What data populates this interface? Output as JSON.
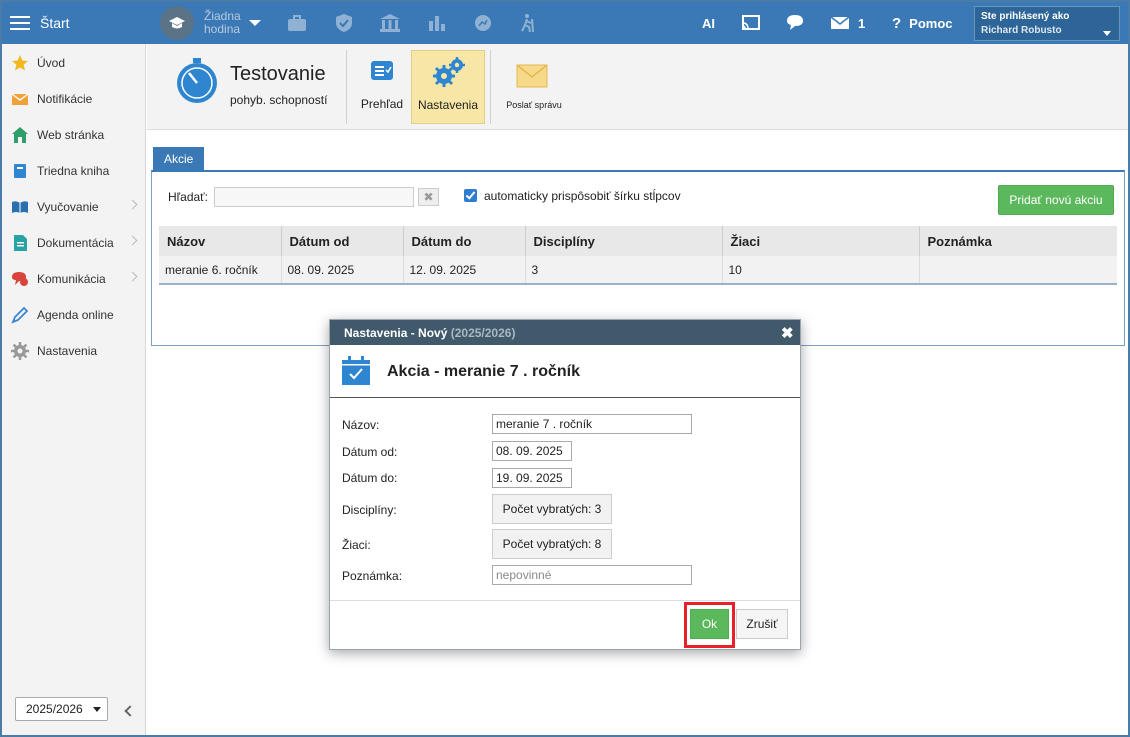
{
  "topbar": {
    "start_label": "Štart",
    "hour_line1": "Žiadna",
    "hour_line2": "hodina",
    "ai_label": "AI",
    "messages_count": "1",
    "help_label": "Pomoc",
    "user_caption": "Ste prihlásený ako",
    "user_name": "Richard Robusto",
    "icons": [
      "briefcase-icon",
      "shield-icon",
      "school-icon",
      "bar-chart-icon",
      "running-ball-icon",
      "hiking-icon",
      "cast-icon",
      "chat-icon",
      "envelope-icon",
      "help-icon"
    ]
  },
  "sidebar": {
    "items": [
      {
        "label": "Úvod",
        "icon": "star-icon"
      },
      {
        "label": "Notifikácie",
        "icon": "envelope-icon"
      },
      {
        "label": "Web stránka",
        "icon": "home-icon"
      },
      {
        "label": "Triedna kniha",
        "icon": "book-icon"
      },
      {
        "label": "Vyučovanie",
        "icon": "open-book-icon"
      },
      {
        "label": "Dokumentácia",
        "icon": "document-icon"
      },
      {
        "label": "Komunikácia",
        "icon": "chat-icon"
      },
      {
        "label": "Agenda online",
        "icon": "pen-icon"
      },
      {
        "label": "Nastavenia",
        "icon": "gear-icon"
      }
    ],
    "year_selected": "2025/2026"
  },
  "module": {
    "title": "Testovanie",
    "subtitle": "pohyb. schopností",
    "tools": {
      "overview": "Prehľad",
      "settings": "Nastavenia",
      "send_message": "Poslať správu"
    }
  },
  "content": {
    "tab_label": "Akcie",
    "search_label": "Hľadať:",
    "search_value": "",
    "autofit_label": "automaticky prispôsobiť šírku stĺpcov",
    "autofit_checked": true,
    "add_button": "Pridať novú akciu",
    "table": {
      "columns": [
        "Názov",
        "Dátum od",
        "Dátum do",
        "Disciplíny",
        "Žiaci",
        "Poznámka"
      ],
      "rows": [
        [
          "meranie 6. ročník",
          "08. 09. 2025",
          "12. 09. 2025",
          "3",
          "10",
          ""
        ]
      ]
    }
  },
  "dialog": {
    "header_title": "Nastavenia - Nový",
    "header_year": "(2025/2026)",
    "title": "Akcia - meranie 7 . ročník",
    "fields": {
      "name_label": "Názov:",
      "name_value": "meranie 7 . ročník",
      "date_from_label": "Dátum od:",
      "date_from_value": "08. 09. 2025",
      "date_to_label": "Dátum do:",
      "date_to_value": "19. 09. 2025",
      "disciplines_label": "Disciplíny:",
      "disciplines_button": "Počet vybratých: 3",
      "students_label": "Žiaci:",
      "students_button": "Počet vybratých: 8",
      "note_label": "Poznámka:",
      "note_placeholder": "nepovinné"
    },
    "ok_label": "Ok",
    "cancel_label": "Zrušiť"
  },
  "colors": {
    "topbar": "#3a79b5",
    "dialog_header": "#405a6b",
    "primary_button": "#5cb85c",
    "highlight": "#e8202a",
    "active_tool": "#f7e6a6"
  }
}
